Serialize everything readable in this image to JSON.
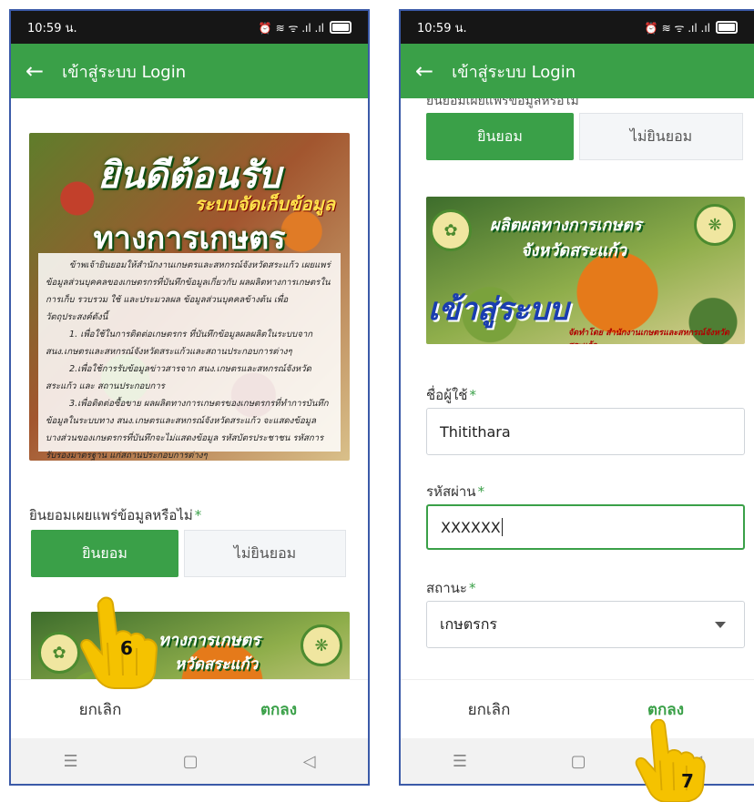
{
  "left": {
    "status_time": "10:59 น.",
    "status_icons": "⏰ ≋ ᯤ .ıl .ıl",
    "back_icon": "arrow-left-icon",
    "title": "เข้าสู่ระบบ Login",
    "banner": {
      "line1": "ยินดีต้อนรับ",
      "line2": "ระบบจัดเก็บข้อมูล",
      "line3": "ทางการเกษตร",
      "terms": [
        "ข้าพเจ้ายินยอมให้สำนักงานเกษตรและสหกรณ์จังหวัดสระแก้ว เผยแพร่ข้อมูลส่วนบุคคลของเกษตรกรที่บันทึกข้อมูลเกี่ยวกับ ผลผลิตทางการเกษตรในการเก็บ รวบรวม ใช้ และประมวลผล ข้อมูลส่วนบุคคลข้างต้น เพื่อวัตถุประสงค์ดังนี้",
        "1. เพื่อใช้ในการติดต่อเกษตรกร ที่บันทึกข้อมูลผลผลิตในระบบจาก สนง.เกษตรและสหกรณ์จังหวัดสระแก้วและสถานประกอบการต่างๆ",
        "2.เพื่อใช้การรับข้อมูลข่าวสารจาก สนง.เกษตรและสหกรณ์จังหวัดสระแก้ว และ สถานประกอบการ",
        "3.เพื่อติดต่อซื้อขาย ผลผลิตทางการเกษตรของเกษตรกรที่ทำการบันทึก ข้อมูลในระบบทาง สนง.เกษตรและสหกรณ์จังหวัดสระแก้ว จะแสดงข้อมูล บางส่วนของเกษตรกรที่บันทึกจะไม่แสดงข้อมูล รหัสบัตรประชาชน รหัสการรับรองมาตรฐาน แก่สถานประกอบการต่างๆ"
      ]
    },
    "consent_label": "ยินยอมเผยแพร่ข้อมูลหรือไม่",
    "required_mark": "*",
    "agree": "ยินยอม",
    "disagree": "ไม่ยินยอม",
    "banner2_text": "ทางการเกษตร",
    "banner2_text2": "หวัดสระแก้ว",
    "cancel": "ยกเลิก",
    "ok": "ตกลง",
    "step": "6"
  },
  "right": {
    "status_time": "10:59 น.",
    "status_icons": "⏰ ≋ ᯤ .ıl .ıl",
    "back_icon": "arrow-left-icon",
    "title": "เข้าสู่ระบบ Login",
    "cut_label": "ยินยอมเผยแพร่ข้อมูลหรือไม่",
    "agree": "ยินยอม",
    "disagree": "ไม่ยินยอม",
    "banner": {
      "line1": "ผลิตผลทางการเกษตร",
      "line2": "จังหวัดสระแก้ว",
      "login": "เข้าสู่ระบบ",
      "credit": "จัดทำโดย สำนักงานเกษตรและสหกรณ์จังหวัดสระแก้ว"
    },
    "username_label": "ชื่อผู้ใช้",
    "username_value": "Thitithara",
    "password_label": "รหัสผ่าน",
    "password_value": "XXXXXX",
    "status_label": "สถานะ",
    "status_value": "เกษตรกร",
    "required_mark": "*",
    "cancel": "ยกเลิก",
    "ok": "ตกลง",
    "step": "7"
  },
  "nav": {
    "recent": "☰",
    "home": "▢",
    "back": "◁"
  },
  "colors": {
    "brand_green": "#3aa048",
    "statusbar": "#161616",
    "frame": "#3b5aa8"
  }
}
